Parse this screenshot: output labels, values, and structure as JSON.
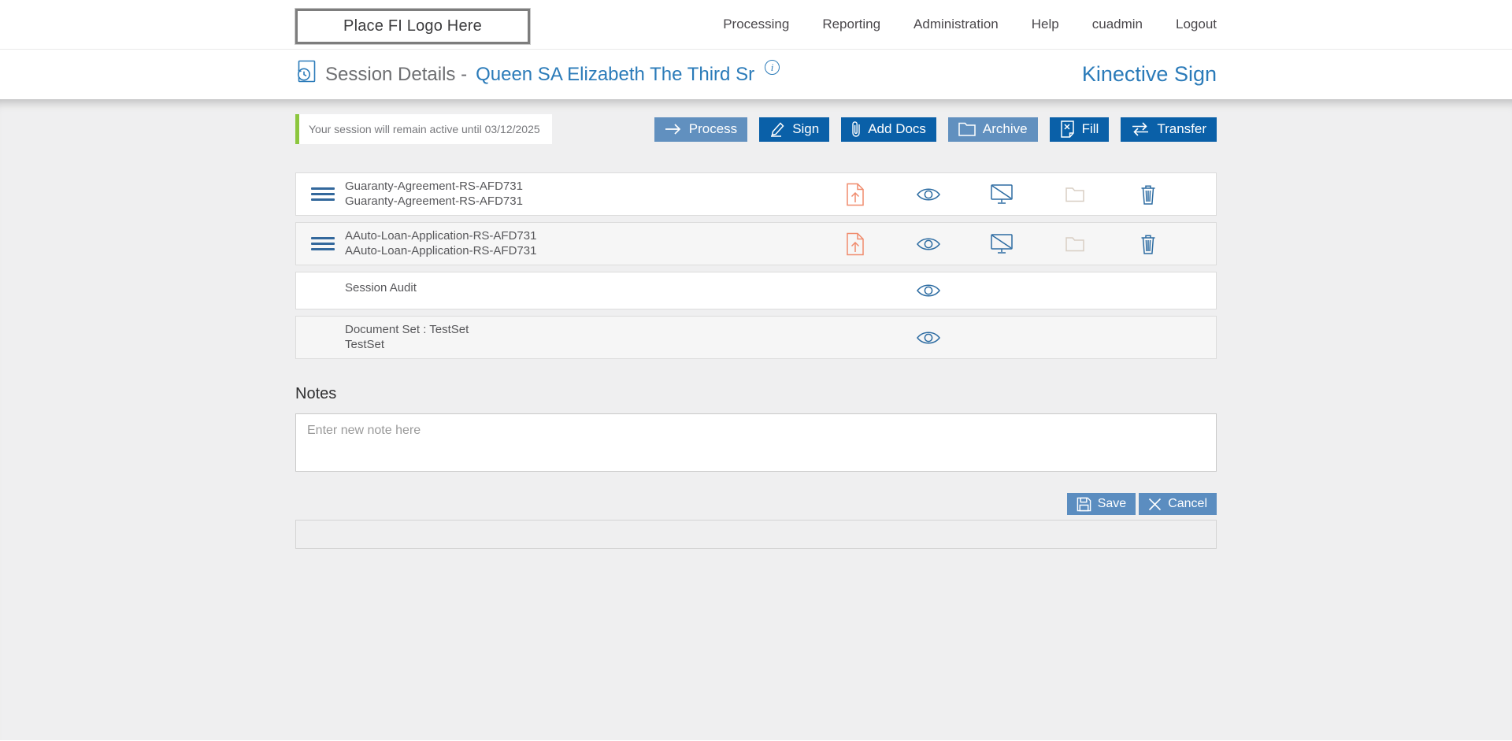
{
  "topnav": {
    "logo_text": "Place FI Logo Here",
    "items": [
      "Processing",
      "Reporting",
      "Administration",
      "Help",
      "cuadmin",
      "Logout"
    ]
  },
  "header": {
    "title": "Session Details -",
    "session_name": "Queen SA Elizabeth The Third Sr",
    "info_symbol": "i",
    "brand": "Kinective Sign"
  },
  "notice": {
    "text": "Your session will remain active until 03/12/2025"
  },
  "actions": [
    {
      "label": "Process",
      "icon": "arrow-right-icon",
      "style": "light"
    },
    {
      "label": "Sign",
      "icon": "pen-icon",
      "style": "dark"
    },
    {
      "label": "Add Docs",
      "icon": "paperclip-icon",
      "style": "dark"
    },
    {
      "label": "Archive",
      "icon": "folder-icon",
      "style": "light"
    },
    {
      "label": "Fill",
      "icon": "doc-x-icon",
      "style": "dark"
    },
    {
      "label": "Transfer",
      "icon": "swap-arrows-icon",
      "style": "dark"
    }
  ],
  "documents": [
    {
      "line1": "Guaranty-Agreement-RS-AFD731",
      "line2": "Guaranty-Agreement-RS-AFD731",
      "icons": [
        "upload",
        "view",
        "display",
        "folder",
        "delete"
      ]
    },
    {
      "line1": "AAuto-Loan-Application-RS-AFD731",
      "line2": "AAuto-Loan-Application-RS-AFD731",
      "icons": [
        "upload",
        "view",
        "display",
        "folder",
        "delete"
      ]
    },
    {
      "line1": "Session Audit",
      "line2": "",
      "icons": [
        "view"
      ]
    },
    {
      "line1": "Document Set : TestSet",
      "line2": "TestSet",
      "icons": [
        "view"
      ]
    }
  ],
  "notes": {
    "heading": "Notes",
    "placeholder": "Enter new note here",
    "save_label": "Save",
    "cancel_label": "Cancel"
  },
  "colors": {
    "accent_dark_blue": "#0a60a8",
    "accent_light_blue": "#6190bf",
    "save_cancel_blue": "#5b8dc0",
    "link_blue": "#2b7bb9",
    "icon_blue": "#2d6ca2",
    "upload_coral": "#f08b6d",
    "disabled_folder": "#d8cec3",
    "notice_green": "#8cc63e",
    "page_background": "#efeff0"
  }
}
